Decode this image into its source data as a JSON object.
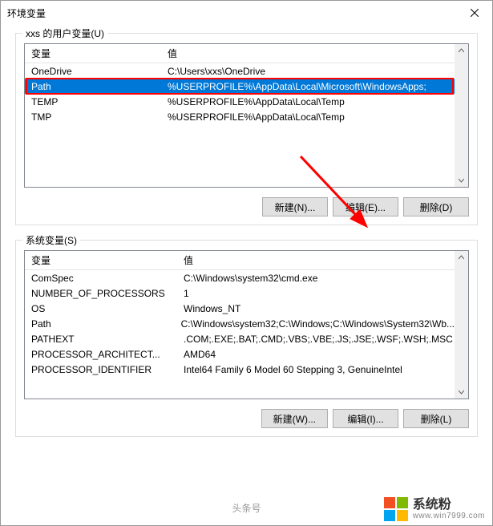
{
  "window": {
    "title": "环境变量"
  },
  "user_section": {
    "title": "xxs 的用户变量(U)",
    "headers": {
      "var": "变量",
      "val": "值"
    },
    "rows": [
      {
        "var": "OneDrive",
        "val": "C:\\Users\\xxs\\OneDrive"
      },
      {
        "var": "Path",
        "val": "%USERPROFILE%\\AppData\\Local\\Microsoft\\WindowsApps;"
      },
      {
        "var": "TEMP",
        "val": "%USERPROFILE%\\AppData\\Local\\Temp"
      },
      {
        "var": "TMP",
        "val": "%USERPROFILE%\\AppData\\Local\\Temp"
      }
    ],
    "buttons": {
      "new": "新建(N)...",
      "edit": "编辑(E)...",
      "delete": "删除(D)"
    }
  },
  "sys_section": {
    "title": "系统变量(S)",
    "headers": {
      "var": "变量",
      "val": "值"
    },
    "rows": [
      {
        "var": "ComSpec",
        "val": "C:\\Windows\\system32\\cmd.exe"
      },
      {
        "var": "NUMBER_OF_PROCESSORS",
        "val": "1"
      },
      {
        "var": "OS",
        "val": "Windows_NT"
      },
      {
        "var": "Path",
        "val": "C:\\Windows\\system32;C:\\Windows;C:\\Windows\\System32\\Wb..."
      },
      {
        "var": "PATHEXT",
        "val": ".COM;.EXE;.BAT;.CMD;.VBS;.VBE;.JS;.JSE;.WSF;.WSH;.MSC"
      },
      {
        "var": "PROCESSOR_ARCHITECT...",
        "val": "AMD64"
      },
      {
        "var": "PROCESSOR_IDENTIFIER",
        "val": "Intel64 Family 6 Model 60 Stepping 3, GenuineIntel"
      }
    ],
    "buttons": {
      "new": "新建(W)...",
      "edit": "编辑(I)...",
      "delete": "删除(L)"
    }
  },
  "watermark": {
    "cn": "系统粉",
    "en": "www.win7999.com",
    "bottom_center": "头条号"
  },
  "colors": {
    "selection": "#0078d7",
    "highlight": "#ff0000",
    "ms_red": "#f25022",
    "ms_green": "#7fba00",
    "ms_blue": "#00a4ef",
    "ms_yellow": "#ffb900"
  }
}
